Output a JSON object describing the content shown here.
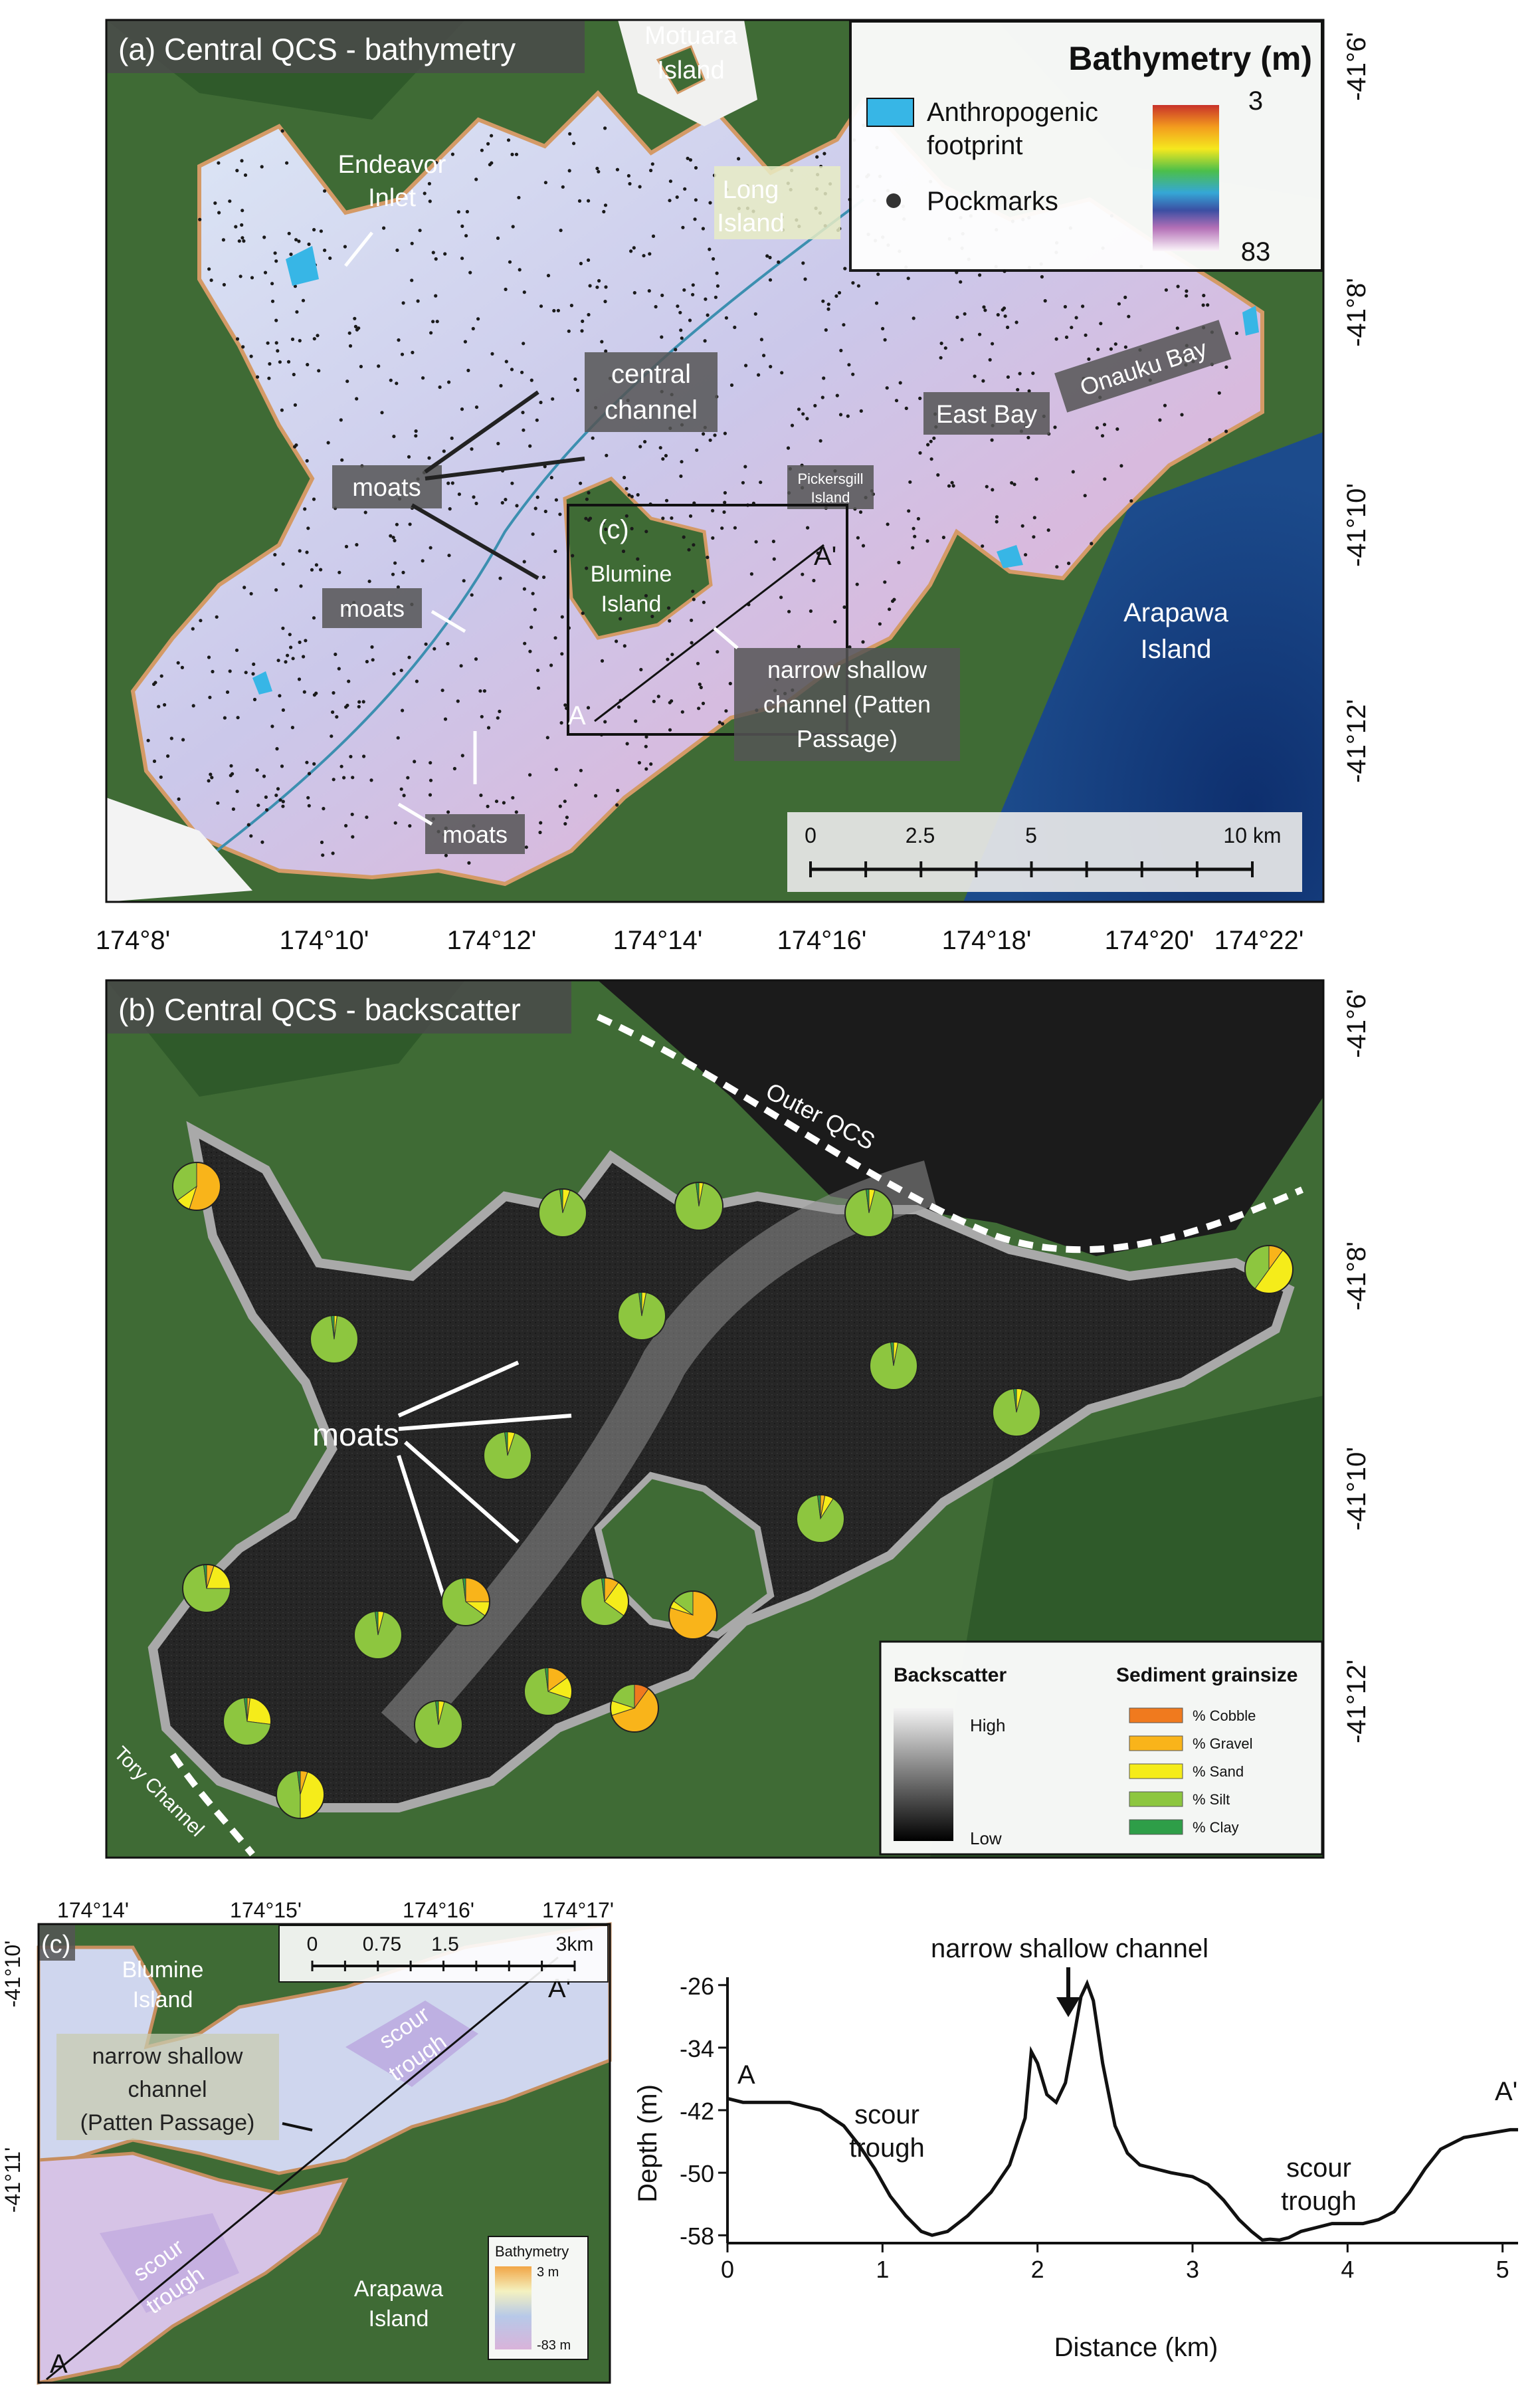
{
  "panel_a": {
    "title": "(a) Central QCS - bathymetry",
    "places": {
      "motuara": [
        "Motuara",
        "Island"
      ],
      "long_island": [
        "Long",
        "Island"
      ],
      "endeavor": [
        "Endeavor",
        "Inlet"
      ],
      "central_channel": [
        "central",
        "channel"
      ],
      "onauku": "Onauku Bay",
      "east_bay": "East Bay",
      "pickersgill": [
        "Pickersgill",
        "Island"
      ],
      "blumine": [
        "Blumine",
        "Island"
      ],
      "arapawa": [
        "Arapawa",
        "Island"
      ],
      "narrow": [
        "narrow shallow",
        "channel (Patten",
        "Passage)"
      ],
      "moats": "moats",
      "inset_c": "(c)",
      "a": "A",
      "a_prime": "A'"
    },
    "legend": {
      "title": "Bathymetry (m)",
      "anthro": [
        "Anthropogenic",
        "footprint"
      ],
      "pockmarks": "Pockmarks",
      "min": "3",
      "max": "83"
    },
    "scalebar": {
      "labels": [
        "0",
        "2.5",
        "5",
        "10 km"
      ]
    },
    "lat_labels": [
      "-41°6'",
      "-41°8'",
      "-41°10'",
      "-41°12'"
    ],
    "colors": {
      "land": "#3f6b35",
      "water_shallow": "#dfe9f5",
      "water_mid": "#c9c6e6",
      "water_deep": "#d7b8dc",
      "anthro": "#37b6e6"
    }
  },
  "lon_labels": [
    "174°8'",
    "174°10'",
    "174°12'",
    "174°14'",
    "174°16'",
    "174°18'",
    "174°20'",
    "174°22'"
  ],
  "panel_b": {
    "title": "(b) Central QCS - backscatter",
    "outer_qcs": "Outer QCS",
    "tory": "Tory Channel",
    "moats": "moats",
    "lat_labels": [
      "-41°6'",
      "-41°8'",
      "-41°10'",
      "-41°12'"
    ],
    "legend": {
      "backscatter": "Backscatter",
      "high": "High",
      "low": "Low",
      "grainsize": "Sediment grainsize",
      "classes": [
        {
          "label": "% Cobble",
          "color": "#f07a1e"
        },
        {
          "label": "% Gravel",
          "color": "#f9b41a"
        },
        {
          "label": "% Sand",
          "color": "#f5ec1a"
        },
        {
          "label": "% Silt",
          "color": "#8dc63f"
        },
        {
          "label": "% Clay",
          "color": "#2e9e48"
        }
      ]
    }
  },
  "panel_c": {
    "title": "(c)",
    "lon_labels": [
      "174°14'",
      "174°15'",
      "174°16'",
      "174°17'"
    ],
    "lat_labels": [
      "-41°10'",
      "-41°11'"
    ],
    "scalebar": [
      "0",
      "0.75",
      "1.5",
      "3km"
    ],
    "blumine": [
      "Blumine",
      "Island"
    ],
    "narrow": [
      "narrow shallow",
      "channel",
      "(Patten Passage)"
    ],
    "scour": [
      "scour",
      "trough"
    ],
    "arapawa": [
      "Arapawa",
      "Island"
    ],
    "a": "A",
    "a_prime": "A'",
    "legend": {
      "title": "Bathymetry",
      "top": "3 m",
      "bottom": "-83 m"
    }
  },
  "chart_data": {
    "type": "line",
    "title": "",
    "xlabel": "Distance (km)",
    "ylabel": "Depth (m)",
    "xlim": [
      0,
      5.1
    ],
    "ylim": [
      -59,
      -25
    ],
    "xticks": [
      0,
      1,
      2,
      3,
      4,
      5
    ],
    "yticks": [
      -26,
      -34,
      -42,
      -50,
      -58
    ],
    "annotations": {
      "narrow": "narrow shallow channel",
      "scour1": [
        "scour",
        "trough"
      ],
      "scour2": [
        "scour",
        "trough"
      ],
      "a": "A",
      "a_prime": "A'"
    },
    "series": [
      {
        "x": [
          0,
          0.1,
          0.2,
          0.4,
          0.6,
          0.75,
          0.85,
          0.95,
          1.05,
          1.15,
          1.25,
          1.32,
          1.42,
          1.55,
          1.7,
          1.82,
          1.92,
          1.96,
          2.0,
          2.06,
          2.12,
          2.18,
          2.24,
          2.28,
          2.32,
          2.36,
          2.42,
          2.5,
          2.58,
          2.66,
          2.76,
          2.86,
          3.0,
          3.1,
          3.2,
          3.3,
          3.38,
          3.45,
          3.5,
          3.56,
          3.62,
          3.7,
          3.8,
          3.9,
          4.0,
          4.1,
          4.2,
          4.3,
          4.4,
          4.5,
          4.6,
          4.75,
          4.9,
          5.05,
          5.1
        ],
        "values": [
          -40.5,
          -41,
          -41,
          -41,
          -42,
          -44,
          -46.5,
          -49.5,
          -53,
          -55.5,
          -57.5,
          -58,
          -57.5,
          -55.5,
          -52.5,
          -49,
          -43,
          -34.5,
          -36,
          -40,
          -41,
          -38.5,
          -32,
          -27.5,
          -25.8,
          -28,
          -36,
          -44,
          -47.5,
          -49,
          -49.5,
          -50,
          -50.5,
          -51.5,
          -53.5,
          -56,
          -57.5,
          -58.6,
          -58.5,
          -58.6,
          -58.3,
          -57.5,
          -57,
          -56.5,
          -56.5,
          -56.5,
          -56,
          -55,
          -52.5,
          -49.5,
          -47,
          -45.5,
          -45,
          -44.5,
          -44.5
        ]
      }
    ]
  }
}
